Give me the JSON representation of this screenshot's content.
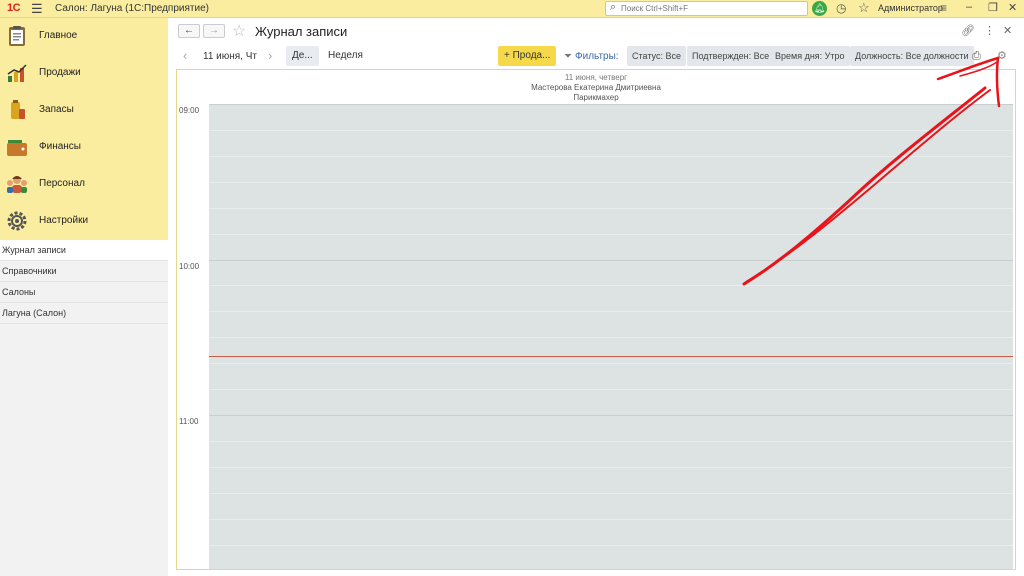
{
  "titlebar": {
    "logo": "1С",
    "app_title": "Салон: Лагуна  (1С:Предприятие)",
    "search_placeholder": "Поиск Ctrl+Shift+F",
    "user": "Администратор"
  },
  "sidebar": {
    "sections": [
      {
        "label": "Главное",
        "icon": "clipboard-icon",
        "color": "#8a6a3a"
      },
      {
        "label": "Продажи",
        "icon": "sales-chart-icon",
        "color": "#3a7a3a"
      },
      {
        "label": "Запасы",
        "icon": "products-icon",
        "color": "#d9a520"
      },
      {
        "label": "Финансы",
        "icon": "wallet-icon",
        "color": "#c8782a"
      },
      {
        "label": "Персонал",
        "icon": "people-icon",
        "color": "#c85a3a"
      },
      {
        "label": "Настройки",
        "icon": "gear-icon",
        "color": "#555555"
      }
    ],
    "nav_items": [
      {
        "label": "Журнал записи",
        "active": true
      },
      {
        "label": "Справочники",
        "active": false
      },
      {
        "label": "Салоны",
        "active": false
      },
      {
        "label": "Лагуна (Салон)",
        "active": false
      }
    ]
  },
  "header": {
    "title": "Журнал записи"
  },
  "toolbar": {
    "date": "11 июня, Чт",
    "day_button": "Де...",
    "week_button": "Неделя",
    "add_button": "+ Прода...",
    "filters_label": "Фильтры:",
    "chips": [
      {
        "label": "Статус: Все"
      },
      {
        "label": "Подтвержден: Все"
      },
      {
        "label": "Время дня: Утро"
      },
      {
        "label": "Должность: Все должности"
      }
    ]
  },
  "calendar": {
    "day_label": "11 июня, четверг",
    "employee": "Мастерова Екатерина Дмитриевна",
    "position": "Парикмахер",
    "hours": [
      "09:00",
      "10:00",
      "11:00"
    ]
  },
  "colors": {
    "accent_yellow": "#fbeda0",
    "grid": "#dde2e2",
    "now_line": "#d05a4a",
    "annotation_arrow": "#e8141a"
  }
}
